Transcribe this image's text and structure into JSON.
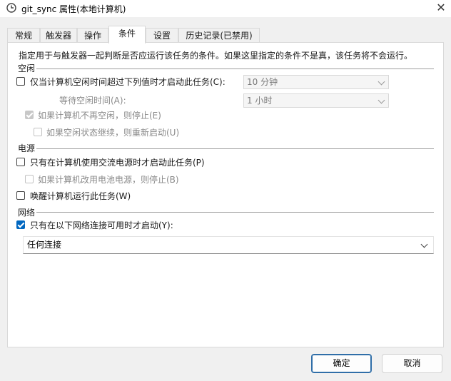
{
  "window": {
    "title": "git_sync 属性(本地计算机)",
    "icon": "clock-icon",
    "close_glyph": "✕"
  },
  "tabs": [
    {
      "label": "常规",
      "active": false
    },
    {
      "label": "触发器",
      "active": false
    },
    {
      "label": "操作",
      "active": false
    },
    {
      "label": "条件",
      "active": true
    },
    {
      "label": "设置",
      "active": false
    },
    {
      "label": "历史记录(已禁用)",
      "active": false
    }
  ],
  "conditions": {
    "description": "指定用于与触发器一起判断是否应运行该任务的条件。如果这里指定的条件不是真，该任务将不会运行。",
    "idle": {
      "group_title": "空闲",
      "start_only_if_idle": {
        "label": "仅当计算机空闲时间超过下列值时才启动此任务(C):",
        "checked": false,
        "value": "10 分钟"
      },
      "wait_for_idle": {
        "label": "等待空闲时间(A):",
        "value": "1 小时"
      },
      "stop_if_not_idle": {
        "label": "如果计算机不再空闲，则停止(E)",
        "checked": true,
        "enabled": false
      },
      "restart_if_idle_resumes": {
        "label": "如果空闲状态继续，则重新启动(U)",
        "checked": false,
        "enabled": false
      }
    },
    "power": {
      "group_title": "电源",
      "ac_only": {
        "label": "只有在计算机使用交流电源时才启动此任务(P)",
        "checked": false
      },
      "stop_on_battery": {
        "label": "如果计算机改用电池电源，则停止(B)",
        "checked": false,
        "enabled": false
      },
      "wake_to_run": {
        "label": "唤醒计算机运行此任务(W)",
        "checked": false
      }
    },
    "network": {
      "group_title": "网络",
      "only_if_network": {
        "label": "只有在以下网络连接可用时才启动(Y):",
        "checked": true
      },
      "connection": "任何连接"
    }
  },
  "buttons": {
    "ok": "确定",
    "cancel": "取消"
  },
  "colors": {
    "accent": "#0067c0",
    "panel_bg": "#ffffff",
    "window_bg": "#f0f0f0"
  }
}
